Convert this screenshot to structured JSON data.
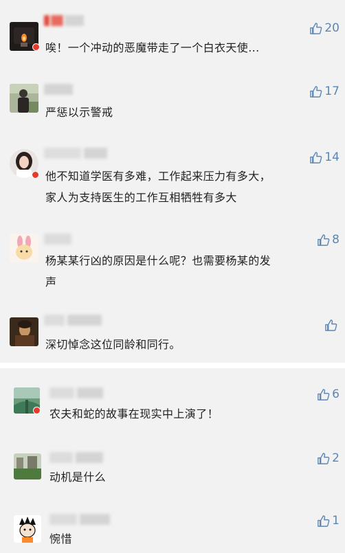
{
  "comments": [
    {
      "likes": "20",
      "text": "唉！一个冲动的恶魔带走了一个白衣天使..."
    },
    {
      "likes": "17",
      "text": "严惩以示警戒"
    },
    {
      "likes": "14",
      "text": "他不知道学医有多难，工作起来压力有多大，\n家人为支持医生的工作互相牺牲有多大"
    },
    {
      "likes": "8",
      "text": "杨某某行凶的原因是什么呢？也需要杨某的发\n声"
    },
    {
      "likes": "",
      "text": "深切悼念这位同龄和同行。"
    },
    {
      "likes": "6",
      "text": "农夫和蛇的故事在现实中上演了！"
    },
    {
      "likes": "2",
      "text": "动机是什么"
    },
    {
      "likes": "1",
      "text": "惋惜"
    }
  ],
  "colors": {
    "like": "#5b86b6",
    "verified_badge": "#e63b2a",
    "background": "#f2f2f2"
  },
  "icons": {
    "like": "thumbs-up-icon"
  }
}
